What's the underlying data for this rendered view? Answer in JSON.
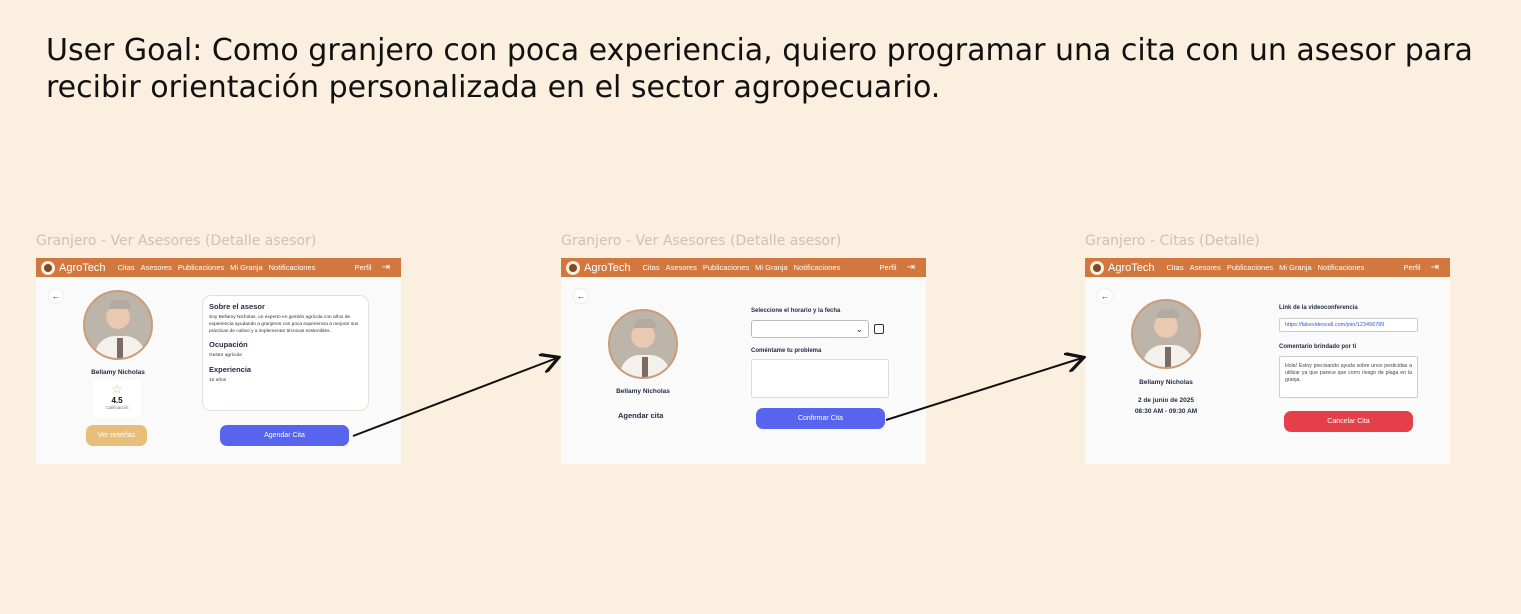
{
  "user_goal": "User Goal: Como granjero con poca experiencia, quiero programar una cita con un asesor para recibir orientación personalizada en el sector agropecuario.",
  "nav": {
    "brand": "AgroTech",
    "items": [
      "Citas",
      "Asesores",
      "Publicaciones",
      "Mi Granja",
      "Notificaciones",
      "Perfil"
    ],
    "logout_icon": "logout-icon"
  },
  "colors": {
    "background": "#fbefdf",
    "navbar": "#d2783f",
    "primary": "#5664ee",
    "secondary": "#e8bf78",
    "danger": "#e5404a"
  },
  "screens": [
    {
      "title": "Granjero - Ver Asesores (Detalle asesor)",
      "advisor_name": "Bellamy Nicholas",
      "rating": {
        "value": "4.5",
        "label": "Calificación",
        "icon": "star-icon"
      },
      "about": {
        "heading": "Sobre el asesor",
        "text": "Soy Bellamy Nicholas, un experto en gestión agrícola con años de experiencia ayudando a granjeros con poca experiencia a mejorar sus prácticas de cultivo y a implementar técnicas sostenibles.",
        "occupation_heading": "Ocupación",
        "occupation": "Gestor agrícola",
        "experience_heading": "Experiencia",
        "experience": "10 años"
      },
      "reviews_button": "Ver reseñas",
      "schedule_button": "Agendar Cita"
    },
    {
      "title": "Granjero - Ver Asesores (Detalle asesor)",
      "advisor_name": "Bellamy Nicholas",
      "section_title": "Agendar cita",
      "schedule_label": "Seleccione el horario y la fecha",
      "problem_label": "Coméntame tu problema",
      "confirm_button": "Confirmar Cita"
    },
    {
      "title": "Granjero - Citas (Detalle)",
      "advisor_name": "Bellamy Nicholas",
      "date": "2 de junio de 2025",
      "time": "08:30 AM - 09:30 AM",
      "link_label": "Link de la videoconferencia",
      "link_value": "https://fakevideocall.com/join/123456789",
      "comment_label": "Comentario brindado por ti",
      "comment_value": "Hola! Estoy precisando ayuda sobre unos pesticidas a utilizar ya que parece que corro riesgo de plaga en la granja.",
      "cancel_button": "Cancelar Cita"
    }
  ]
}
